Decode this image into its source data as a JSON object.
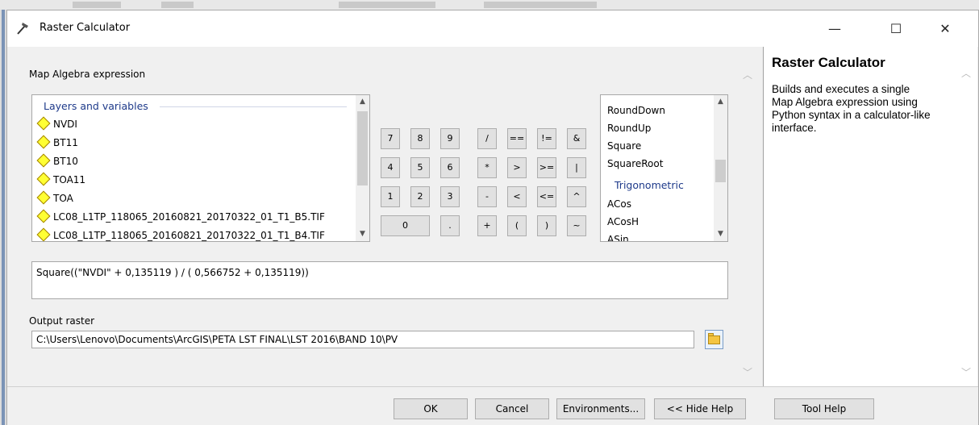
{
  "window": {
    "title": "Raster Calculator",
    "controls": {
      "minimize": "—",
      "maximize": "☐",
      "close": "✕"
    }
  },
  "main": {
    "expression_label": "Map Algebra expression",
    "layers": {
      "group_label": "Layers and variables",
      "items": [
        "NVDI",
        "BT11",
        "BT10",
        "TOA11",
        "TOA",
        "LC08_L1TP_118065_20160821_20170322_01_T1_B5.TIF",
        "LC08_L1TP_118065_20160821_20170322_01_T1_B4.TIF"
      ]
    },
    "calculator_buttons": [
      "7",
      "8",
      "9",
      "/",
      "==",
      "!=",
      "&",
      "4",
      "5",
      "6",
      "*",
      ">",
      ">=",
      "|",
      "1",
      "2",
      "3",
      "-",
      "<",
      "<=",
      "^",
      "0",
      ".",
      "+",
      "(",
      ")",
      "~"
    ],
    "functions": {
      "items_top": [
        "RoundDown",
        "RoundUp",
        "Square",
        "SquareRoot"
      ],
      "group_label": "Trigonometric",
      "items_bottom": [
        "ACos",
        "ACosH",
        "ASin"
      ]
    },
    "expression_value": "Square((\"NVDI\" + 0,135119 ) / ( 0,566752 + 0,135119))",
    "output_label": "Output raster",
    "output_value": "C:\\Users\\Lenovo\\Documents\\ArcGIS\\PETA LST FINAL\\LST 2016\\BAND 10\\PV"
  },
  "help": {
    "title": "Raster Calculator",
    "body": "Builds and executes a single Map Algebra expression using Python syntax in a calculator-like interface."
  },
  "buttons": {
    "ok": "OK",
    "cancel": "Cancel",
    "environments": "Environments...",
    "hide_help": "<< Hide Help",
    "tool_help": "Tool Help"
  }
}
